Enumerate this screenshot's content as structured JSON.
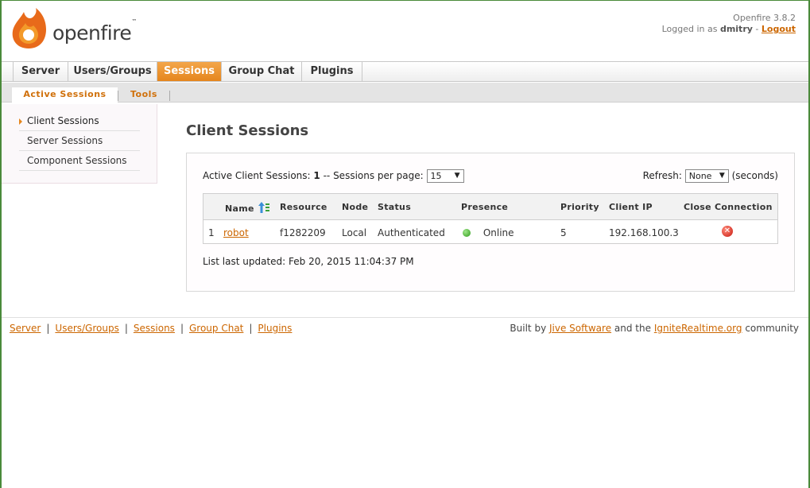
{
  "header": {
    "logo_text": "openfire",
    "logo_tm": "™",
    "version": "Openfire 3.8.2",
    "logged_in_prefix": "Logged in as",
    "username": "dmitry",
    "dash": "-",
    "logout_label": "Logout"
  },
  "tabs": [
    {
      "label": "Server"
    },
    {
      "label": "Users/Groups"
    },
    {
      "label": "Sessions",
      "active": true
    },
    {
      "label": "Group Chat"
    },
    {
      "label": "Plugins"
    }
  ],
  "subtabs": [
    {
      "label": "Active Sessions",
      "active": true
    },
    {
      "label": "Tools"
    }
  ],
  "sidebar": {
    "items": [
      {
        "label": "Client Sessions",
        "current": true
      },
      {
        "label": "Server Sessions"
      },
      {
        "label": "Component Sessions"
      }
    ]
  },
  "main": {
    "title": "Client Sessions",
    "active_label": "Active Client Sessions:",
    "active_count": "1",
    "per_page_label": "-- Sessions per page:",
    "per_page_value": "15",
    "refresh_label": "Refresh:",
    "refresh_value": "None",
    "refresh_unit": "(seconds)",
    "table": {
      "headers": [
        "Name",
        "Resource",
        "Node",
        "Status",
        "Presence",
        "Priority",
        "Client IP",
        "Close Connection"
      ],
      "rows": [
        {
          "index": "1",
          "name": "robot",
          "resource": "f1282209",
          "node": "Local",
          "status": "Authenticated",
          "presence": "Online",
          "priority": "5",
          "client_ip": "192.168.100.3"
        }
      ]
    },
    "updated": "List last updated: Feb 20, 2015 11:04:37 PM"
  },
  "footer": {
    "links": [
      "Server",
      "Users/Groups",
      "Sessions",
      "Group Chat",
      "Plugins"
    ],
    "separator": "|",
    "built_by": "Built by",
    "jive": "Jive Software",
    "and_the": "and the",
    "ignite": "IgniteRealtime.org",
    "community": "community"
  },
  "colors": {
    "accent": "#e5861d",
    "link": "#cc6600",
    "online": "#2e9a1a",
    "close": "#c81a10"
  },
  "icons": [
    "flame-logo-icon",
    "sort-ascending-icon",
    "online-status-icon",
    "close-connection-icon",
    "arrow-right-icon"
  ]
}
